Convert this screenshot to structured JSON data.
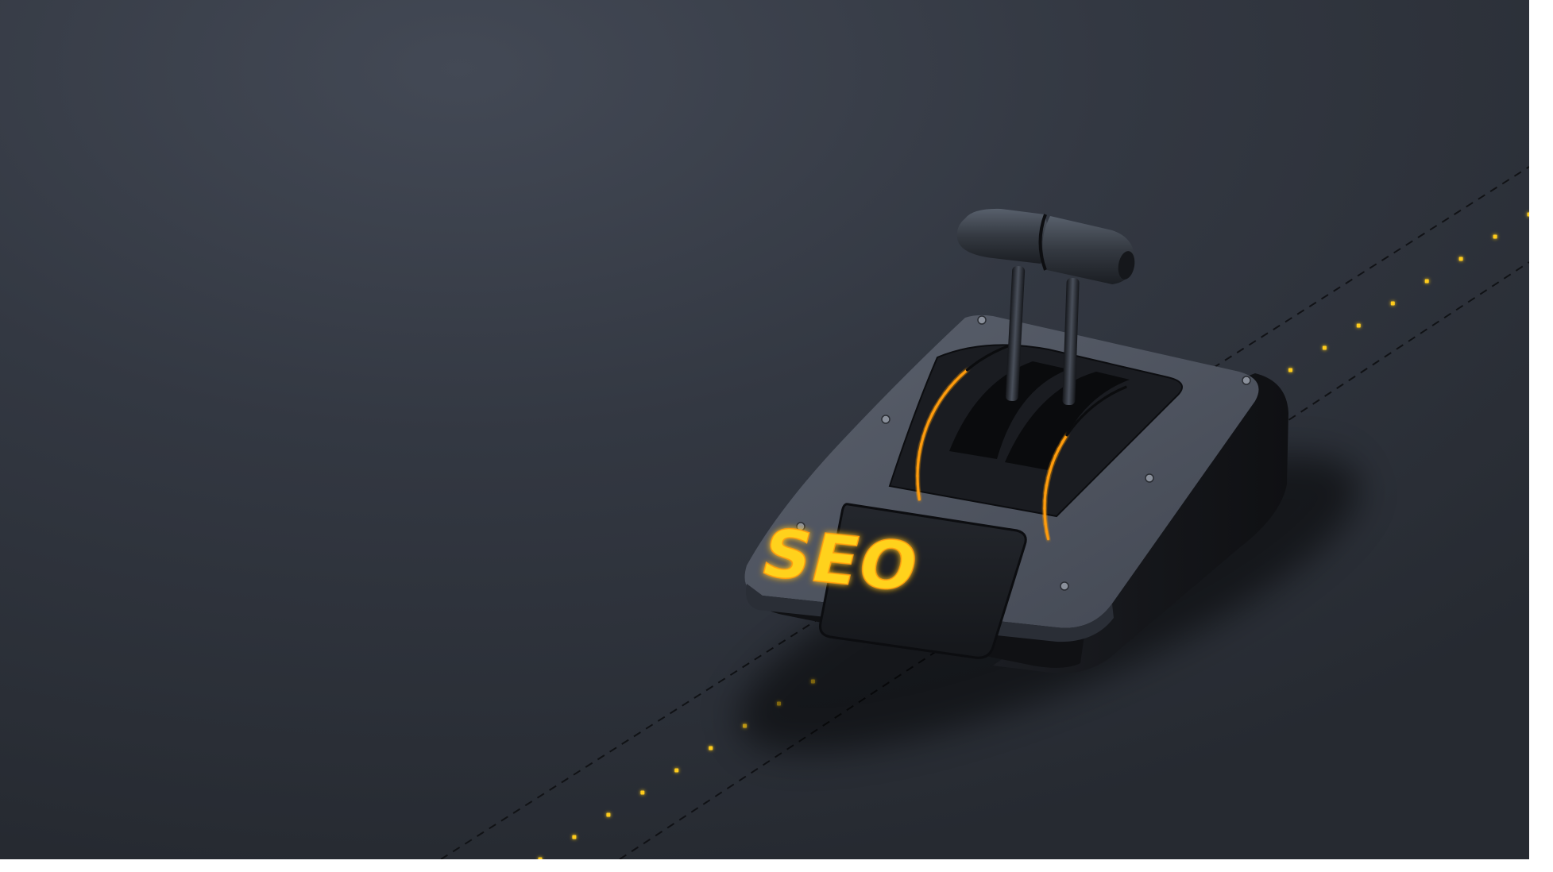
{
  "scene": {
    "label_text": "SEO",
    "accent_color": "#ffcc1a",
    "glow_color": "#ff9c10",
    "background_color": "#2b2f38",
    "object": "throttle-lever-control",
    "lever_level_left": 0.25,
    "lever_level_right": 0.45
  }
}
